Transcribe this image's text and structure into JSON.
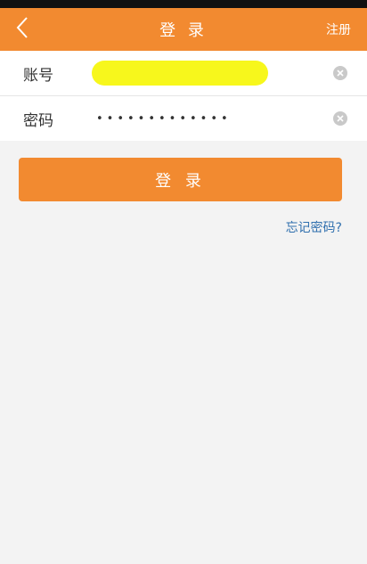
{
  "navbar": {
    "title": "登 录",
    "register_label": "注册"
  },
  "form": {
    "account_label": "账号",
    "account_value": "",
    "password_label": "密码",
    "password_value": "•••••••••••••"
  },
  "actions": {
    "login_label": "登 录",
    "forgot_label": "忘记密码?"
  },
  "colors": {
    "accent": "#f28a30",
    "link": "#2f6fae",
    "redaction": "#f7f71c"
  }
}
